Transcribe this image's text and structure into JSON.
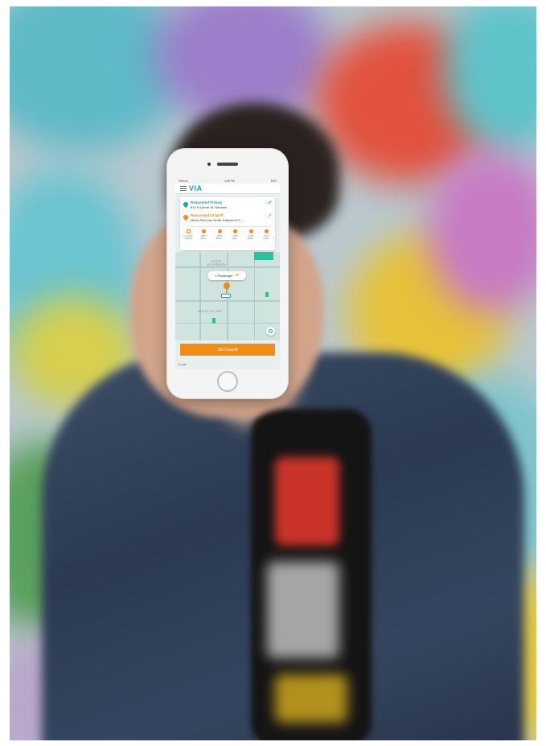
{
  "status_bar": {
    "carrier": "Verizon",
    "time": "4:38 PM",
    "battery": "84%"
  },
  "app": {
    "brand": "VIA"
  },
  "route": {
    "pickup_title": "Requested Pickup",
    "pickup_address": "812 N Lamer St, Burbank",
    "dropoff_title": "Requested Dropoff",
    "dropoff_address": "Metro Red Line North Hollywood S..."
  },
  "suggestions": [
    {
      "line1": "Live Work",
      "line2": "Cabana"
    },
    {
      "line1": "1000 S",
      "line2": "Avalo..."
    },
    {
      "line1": "9851",
      "line2": "Brock..."
    },
    {
      "line1": "2065",
      "line2": "Sage..."
    },
    {
      "line1": "4-10 N.",
      "line2": "El Mo..."
    },
    {
      "line1": "2017",
      "line2": "Petun..."
    }
  ],
  "map": {
    "label_north_hollywood": "NORTH HOLLYWOOD",
    "label_valley_village": "VALLEY VILLAGE",
    "passenger_count": "1 Passenger",
    "attribution": "Google"
  },
  "actions": {
    "set_dropoff": "Set Dropoff"
  },
  "colors": {
    "brand_teal": "#1aa0b8",
    "accent_orange": "#f28c18"
  },
  "icons": [
    "menu-icon",
    "pickup-pin-icon",
    "dropoff-pin-icon",
    "edit-icon",
    "plus-icon",
    "map-pin-icon",
    "car-icon",
    "locate-icon",
    "chevron-right-icon"
  ]
}
